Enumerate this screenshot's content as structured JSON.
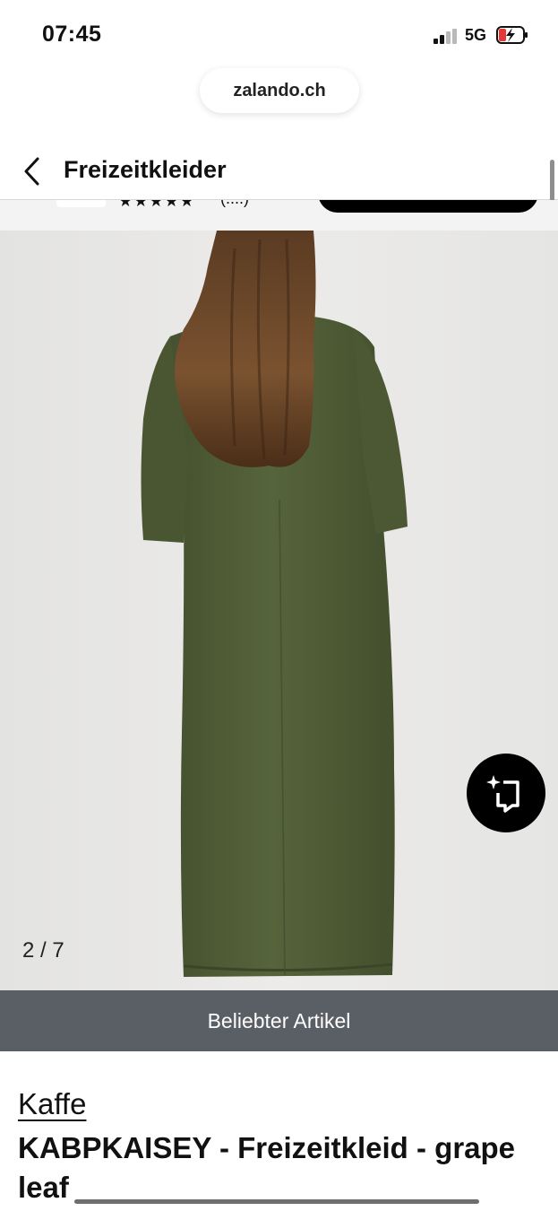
{
  "status": {
    "time": "07:45",
    "network": "5G"
  },
  "browser": {
    "url": "zalando.ch"
  },
  "header": {
    "title": "Freizeitkleider",
    "back_icon": "chevron-left-icon"
  },
  "gallery": {
    "counter": "2 / 7",
    "current_image": 2,
    "total_images": 7,
    "try_on_icon": "sparkle-crop-icon",
    "background_color": "#e6e6e4",
    "dress_color": "#4c5a35"
  },
  "banner": {
    "label": "Beliebter Artikel",
    "color": "#5a5e65"
  },
  "product": {
    "brand": "Kaffe",
    "name": "KABPKAISEY - Freizeitkleid - grape leaf"
  }
}
